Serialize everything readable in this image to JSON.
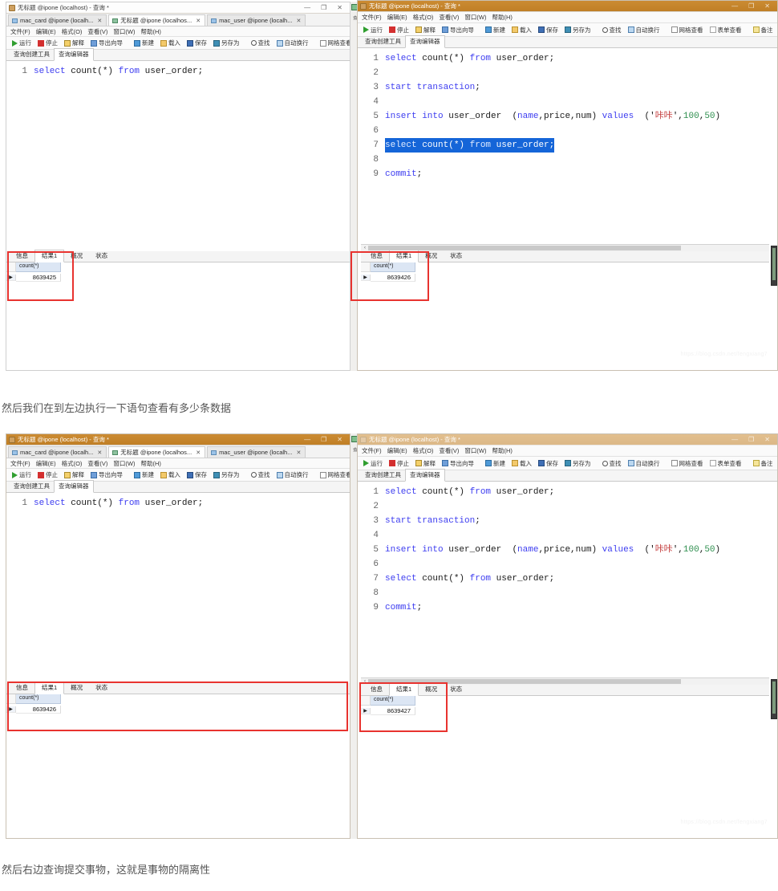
{
  "captions": {
    "middle": "然后我们在到左边执行一下语句查看有多少条数据",
    "bottom": "然后右边查询提交事物，这就是事物的隔离性"
  },
  "watermark": "https://blog.csdn.net/fengxiang7",
  "window_common": {
    "title": "无标题 @ipone (localhost) - 查询 *",
    "min_label": "—",
    "max_label": "❐",
    "close_label": "✕",
    "doc_tabs": [
      {
        "label": "mac_card @ipone (localh...",
        "close": "✕",
        "active": false
      },
      {
        "label": "无标题 @ipone (localhos...",
        "close": "✕",
        "active": true
      },
      {
        "label": "mac_user @ipone (localh...",
        "close": "✕",
        "active": false
      }
    ],
    "menus": [
      "文件(F)",
      "编辑(E)",
      "格式(O)",
      "查看(V)",
      "窗口(W)",
      "帮助(H)"
    ],
    "toolbar": [
      {
        "label": "运行",
        "icon": "run-icon"
      },
      {
        "label": "停止",
        "icon": "stop-icon"
      },
      {
        "label": "解释",
        "icon": "explain-icon"
      },
      {
        "label": "导出向导",
        "icon": "export-wizard-icon"
      },
      {
        "label": "新建",
        "icon": "new-icon"
      },
      {
        "label": "载入",
        "icon": "load-icon"
      },
      {
        "label": "保存",
        "icon": "save-icon"
      },
      {
        "label": "另存为",
        "icon": "save-as-icon"
      },
      {
        "label": "查找",
        "icon": "find-icon"
      },
      {
        "label": "自动换行",
        "icon": "word-wrap-icon"
      },
      {
        "label": "网格查看",
        "icon": "grid-view-icon"
      },
      {
        "label": "表单查看",
        "icon": "form-view-icon"
      },
      {
        "label": "备注",
        "icon": "note-icon"
      }
    ],
    "toolbar_overflow": "»",
    "sub_tabs": [
      {
        "label": "查询创建工具",
        "active": false
      },
      {
        "label": "查询编辑器",
        "active": true
      }
    ],
    "result_tabs": [
      {
        "label": "信息",
        "active": false
      },
      {
        "label": "结果1",
        "active": true
      },
      {
        "label": "概况",
        "active": false
      },
      {
        "label": "状态",
        "active": false
      }
    ],
    "grid_column": "count(*)",
    "row_marker": "▶"
  },
  "colors": {
    "titlebar_tan": "#c4862f",
    "titlebar_light": "#fdfdfd",
    "keyword": "#3d3df0",
    "string": "#c33a3a",
    "number": "#2f8f4f",
    "selection_bg": "#1565d8",
    "annotation_red": "#e8332f"
  },
  "shots": [
    {
      "id": "top",
      "left": {
        "titlebar_style": "light",
        "editor_lines": [
          {
            "n": "1",
            "tokens": [
              {
                "t": "select",
                "c": "kw"
              },
              {
                "t": " count(*) ",
                "c": ""
              },
              {
                "t": "from",
                "c": "kw"
              },
              {
                "t": " user_order;",
                "c": ""
              }
            ]
          }
        ],
        "result_value": "8639425"
      },
      "right": {
        "titlebar_style": "tan",
        "editor_lines": [
          {
            "n": "1",
            "sel": false,
            "tokens": [
              {
                "t": "select",
                "c": "kw"
              },
              {
                "t": " count(*) ",
                "c": ""
              },
              {
                "t": "from",
                "c": "kw"
              },
              {
                "t": " user_order;",
                "c": ""
              }
            ]
          },
          {
            "n": "2",
            "sel": false,
            "tokens": [
              {
                "t": "",
                "c": ""
              }
            ]
          },
          {
            "n": "3",
            "sel": false,
            "tokens": [
              {
                "t": "start transaction",
                "c": "kw"
              },
              {
                "t": ";",
                "c": ""
              }
            ]
          },
          {
            "n": "4",
            "sel": false,
            "tokens": [
              {
                "t": "",
                "c": ""
              }
            ]
          },
          {
            "n": "5",
            "sel": false,
            "tokens": [
              {
                "t": "insert into",
                "c": "kw"
              },
              {
                "t": " user_order  (",
                "c": ""
              },
              {
                "t": "name",
                "c": "kw"
              },
              {
                "t": ",price,num) ",
                "c": ""
              },
              {
                "t": "values",
                "c": "kw"
              },
              {
                "t": "  ('",
                "c": ""
              },
              {
                "t": "咔咔",
                "c": "str"
              },
              {
                "t": "',",
                "c": ""
              },
              {
                "t": "100",
                "c": "num"
              },
              {
                "t": ",",
                "c": ""
              },
              {
                "t": "50",
                "c": "num"
              },
              {
                "t": ")",
                "c": ""
              }
            ]
          },
          {
            "n": "6",
            "sel": false,
            "tokens": [
              {
                "t": "",
                "c": ""
              }
            ]
          },
          {
            "n": "7",
            "sel": true,
            "tokens": [
              {
                "t": "select",
                "c": "kw"
              },
              {
                "t": " count(*) ",
                "c": ""
              },
              {
                "t": "from",
                "c": "kw"
              },
              {
                "t": " user_order;",
                "c": ""
              }
            ]
          },
          {
            "n": "8",
            "sel": false,
            "tokens": [
              {
                "t": "",
                "c": ""
              }
            ]
          },
          {
            "n": "9",
            "sel": false,
            "tokens": [
              {
                "t": "commit",
                "c": "kw"
              },
              {
                "t": ";",
                "c": ""
              }
            ]
          }
        ],
        "result_value": "8639426"
      }
    },
    {
      "id": "bottom",
      "left": {
        "titlebar_style": "tan",
        "editor_lines": [
          {
            "n": "1",
            "tokens": [
              {
                "t": "select",
                "c": "kw"
              },
              {
                "t": " count(*) ",
                "c": ""
              },
              {
                "t": "from",
                "c": "kw"
              },
              {
                "t": " user_order;",
                "c": ""
              }
            ]
          }
        ],
        "result_value": "8639426"
      },
      "right": {
        "titlebar_style": "tan",
        "editor_lines": [
          {
            "n": "1",
            "sel": false,
            "tokens": [
              {
                "t": "select",
                "c": "kw"
              },
              {
                "t": " count(*) ",
                "c": ""
              },
              {
                "t": "from",
                "c": "kw"
              },
              {
                "t": " user_order;",
                "c": ""
              }
            ]
          },
          {
            "n": "2",
            "sel": false,
            "tokens": [
              {
                "t": "",
                "c": ""
              }
            ]
          },
          {
            "n": "3",
            "sel": false,
            "tokens": [
              {
                "t": "start transaction",
                "c": "kw"
              },
              {
                "t": ";",
                "c": ""
              }
            ]
          },
          {
            "n": "4",
            "sel": false,
            "tokens": [
              {
                "t": "",
                "c": ""
              }
            ]
          },
          {
            "n": "5",
            "sel": false,
            "tokens": [
              {
                "t": "insert into",
                "c": "kw"
              },
              {
                "t": " user_order  (",
                "c": ""
              },
              {
                "t": "name",
                "c": "kw"
              },
              {
                "t": ",price,num) ",
                "c": ""
              },
              {
                "t": "values",
                "c": "kw"
              },
              {
                "t": "  ('",
                "c": ""
              },
              {
                "t": "咔咔",
                "c": "str"
              },
              {
                "t": "',",
                "c": ""
              },
              {
                "t": "100",
                "c": "num"
              },
              {
                "t": ",",
                "c": ""
              },
              {
                "t": "50",
                "c": "num"
              },
              {
                "t": ")",
                "c": ""
              }
            ]
          },
          {
            "n": "6",
            "sel": false,
            "tokens": [
              {
                "t": "",
                "c": ""
              }
            ]
          },
          {
            "n": "7",
            "sel": false,
            "tokens": [
              {
                "t": "select",
                "c": "kw"
              },
              {
                "t": " count(*) ",
                "c": ""
              },
              {
                "t": "from",
                "c": "kw"
              },
              {
                "t": " user_order;",
                "c": ""
              }
            ]
          },
          {
            "n": "8",
            "sel": false,
            "tokens": [
              {
                "t": "",
                "c": ""
              }
            ]
          },
          {
            "n": "9",
            "sel": false,
            "tokens": [
              {
                "t": "commit",
                "c": "kw"
              },
              {
                "t": ";",
                "c": ""
              }
            ]
          }
        ],
        "result_value": "8639427"
      }
    }
  ]
}
